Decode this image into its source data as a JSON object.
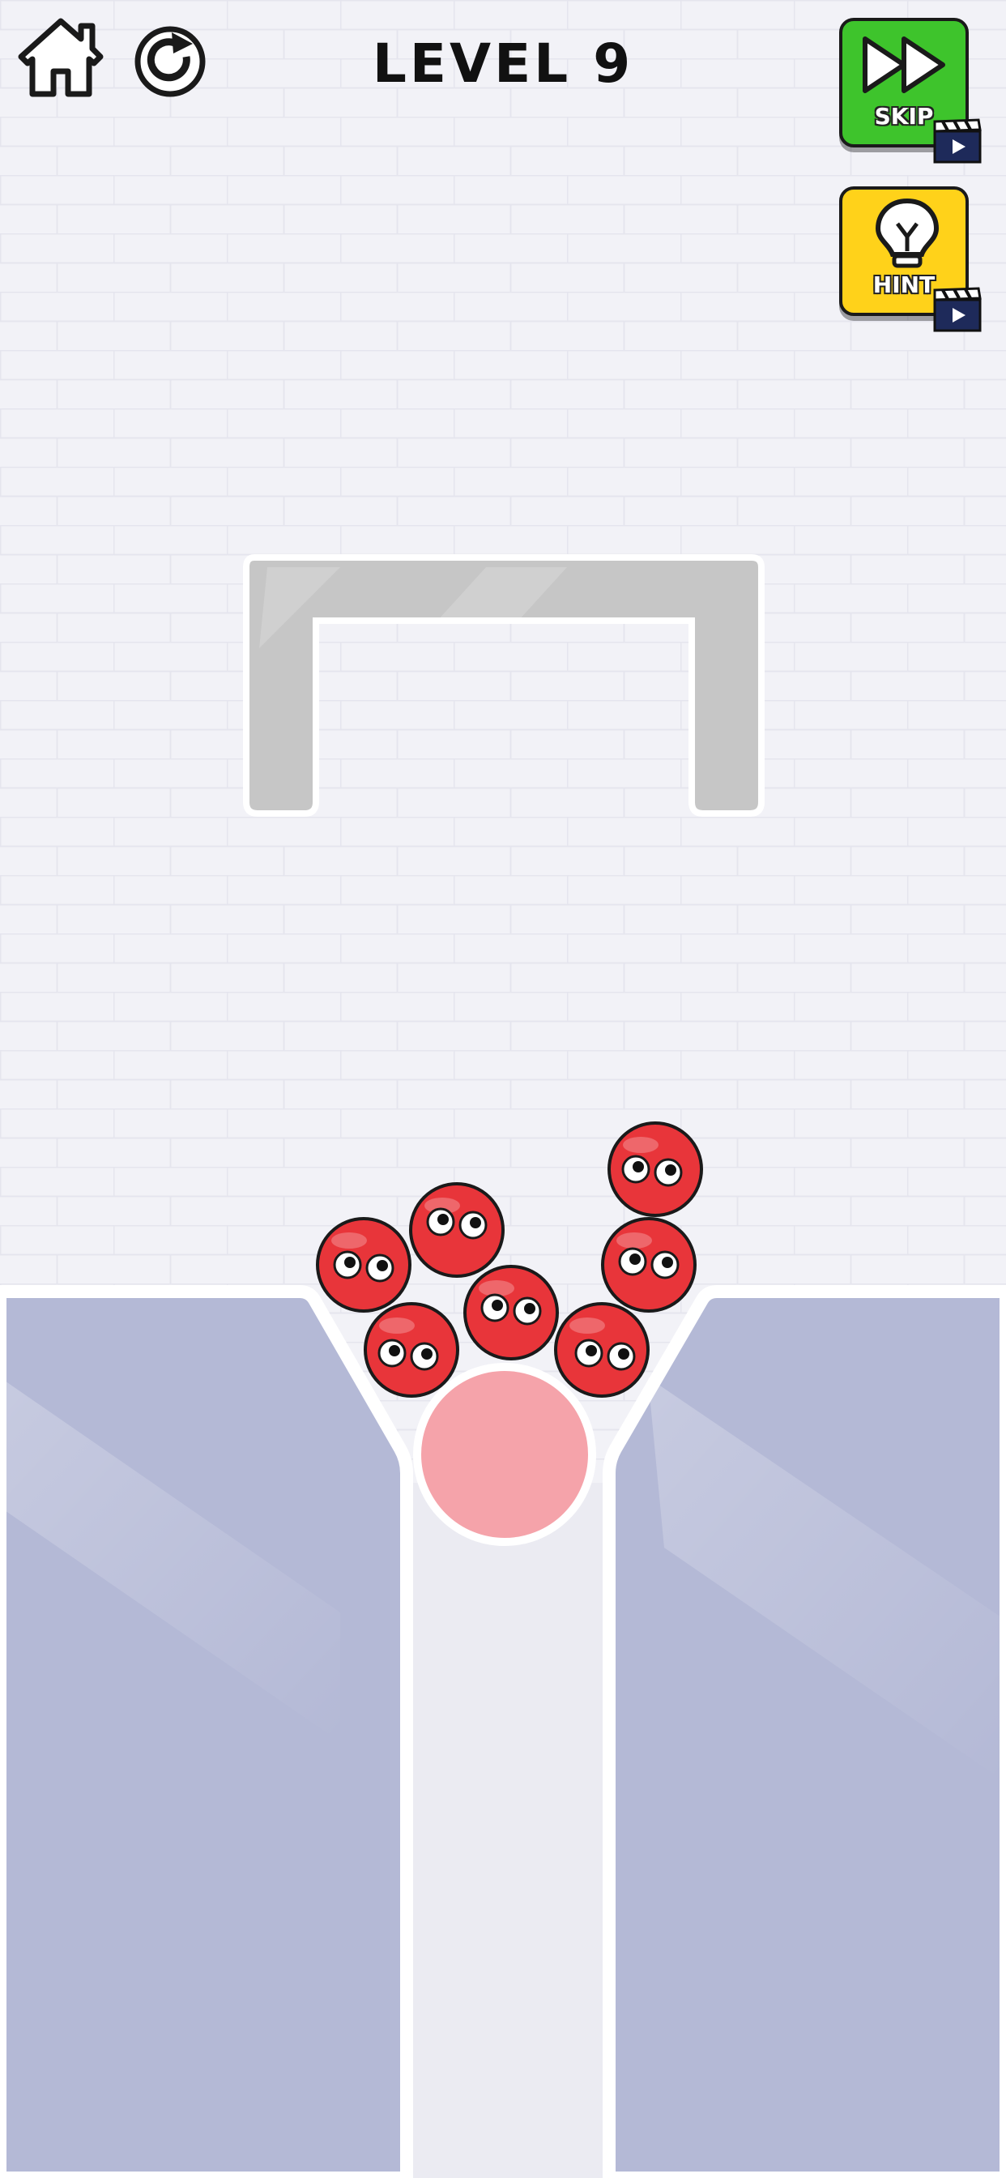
{
  "header": {
    "level_title": "LEVEL 9"
  },
  "buttons": {
    "home": {
      "icon": "house-icon"
    },
    "restart": {
      "icon": "restart-icon"
    },
    "skip": {
      "label": "SKIP",
      "icon": "fast-forward-icon",
      "ad_icon": "clapperboard-icon",
      "color": "#3ec42c"
    },
    "hint": {
      "label": "HINT",
      "icon": "lightbulb-icon",
      "ad_icon": "clapperboard-icon",
      "color": "#ffd21a"
    }
  },
  "game": {
    "ball_color": "#e8353a",
    "ball_count": 8,
    "target_color": "#f5a3aa",
    "container_color": "#b4b9d6",
    "bracket_color": "#c6c6c6"
  }
}
